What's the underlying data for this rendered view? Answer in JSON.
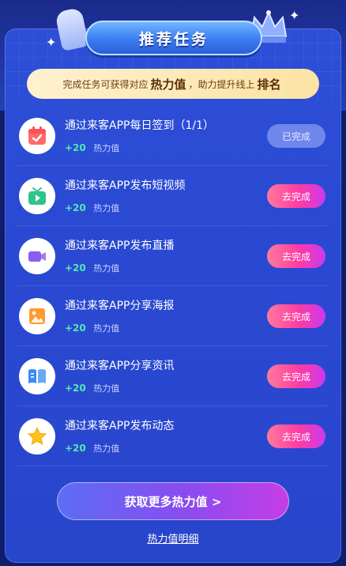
{
  "header": {
    "title": "推荐任务"
  },
  "notice": {
    "prefix": "完成任务可获得对应",
    "highlight1": "热力值",
    "middle": "，助力提升线上",
    "highlight2": "排名"
  },
  "tasks": [
    {
      "title": "通过来客APP每日签到（1/1）",
      "reward": "+20",
      "reward_label": "热力值",
      "button": "已完成",
      "status": "done",
      "icon": "calendar-check-icon",
      "icon_color": "#ff6b6b",
      "icon_bg": "#ffecee"
    },
    {
      "title": "通过来客APP发布短视频",
      "reward": "+20",
      "reward_label": "热力值",
      "button": "去完成",
      "status": "todo",
      "icon": "tv-play-icon",
      "icon_color": "#2fc48a",
      "icon_bg": "#e8fbf3"
    },
    {
      "title": "通过来客APP发布直播",
      "reward": "+20",
      "reward_label": "热力值",
      "button": "去完成",
      "status": "todo",
      "icon": "video-camera-icon",
      "icon_color": "#8a5cf0",
      "icon_bg": "#f1ebff"
    },
    {
      "title": "通过来客APP分享海报",
      "reward": "+20",
      "reward_label": "热力值",
      "button": "去完成",
      "status": "todo",
      "icon": "image-icon",
      "icon_color": "#ff9a2e",
      "icon_bg": "#fff3e4"
    },
    {
      "title": "通过来客APP分享资讯",
      "reward": "+20",
      "reward_label": "热力值",
      "button": "去完成",
      "status": "todo",
      "icon": "book-open-icon",
      "icon_color": "#3d8bf2",
      "icon_bg": "#e8f2ff"
    },
    {
      "title": "通过来客APP发布动态",
      "reward": "+20",
      "reward_label": "热力值",
      "button": "去完成",
      "status": "todo",
      "icon": "star-icon",
      "icon_color": "#ffc21a",
      "icon_bg": "#fff7dd"
    }
  ],
  "cta": {
    "label": "获取更多热力值 >"
  },
  "footer": {
    "link_label": "热力值明细"
  },
  "colors": {
    "background": "#0f1e6b",
    "panel": "#2d4fd8",
    "reward": "#52e6b4",
    "button_go_start": "#ff7a9c",
    "button_go_end": "#c83af0",
    "button_done": "#6f86ea"
  }
}
